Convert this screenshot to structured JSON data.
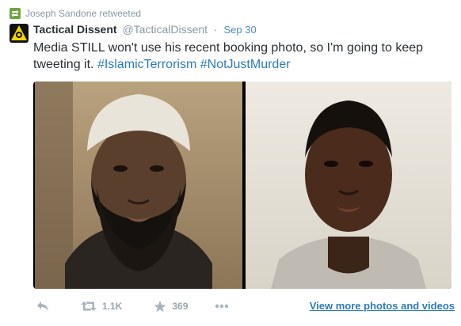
{
  "retweet": {
    "icon": "retweet-icon",
    "text": "Joseph Sandone retweeted"
  },
  "tweet": {
    "avatar_icon": "tactical-dissent-logo-icon",
    "name": "Tactical Dissent",
    "handle": "@TacticalDissent",
    "separator": "·",
    "date": "Sep 30",
    "text_plain": "Media STILL won't use his recent booking photo, so I'm going to keep tweeting it.",
    "hashtags": [
      "#IslamicTerrorism",
      "#NotJustMurder"
    ]
  },
  "actions": {
    "reply_icon": "reply-icon",
    "retweet_icon": "retweet-icon",
    "retweet_count": "1.1K",
    "favorite_icon": "star-icon",
    "favorite_count": "369",
    "more_icon": "more-dots-icon",
    "view_more": "View more photos and videos"
  },
  "colors": {
    "link": "#2b7bb9",
    "muted": "#8899a6",
    "retweet_green": "#5c913b",
    "avatar_yellow": "#f5d400"
  }
}
